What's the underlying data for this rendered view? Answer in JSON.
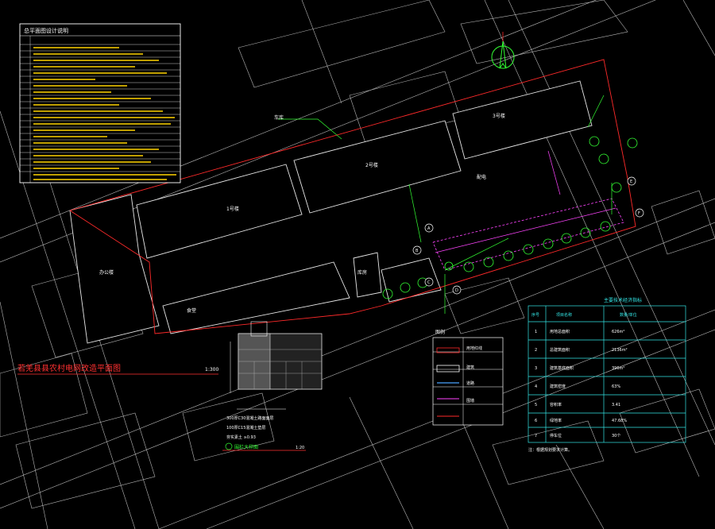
{
  "notes": {
    "title": "总平面图设计说明",
    "lines": [
      "1、本图尺寸以米计",
      "2、设计依据",
      "3、本工程建设用地范围",
      "4、室外地坪标高"
    ]
  },
  "drawing_title": {
    "text": "若羌县县农村电网改造平面图",
    "scale": "1:300"
  },
  "buildings": {
    "b1": "1号楼",
    "b2": "2号楼",
    "b3": "3号楼",
    "b4": "办公楼",
    "b5": "食堂",
    "b6": "库房",
    "b7": "配电",
    "b8": "车库"
  },
  "markers": [
    "A",
    "B",
    "C",
    "D",
    "E",
    "F"
  ],
  "legend": {
    "title": "图例",
    "items": [
      "用地红线",
      "建筑",
      "道路",
      "围墙"
    ]
  },
  "section": {
    "title": "围栏大样图",
    "scale": "1:20",
    "notes": [
      "300厚C30混凝土路面面层",
      "100厚C15混凝土垫层",
      "夯实素土 ≥0.93"
    ]
  },
  "table": {
    "title": "主要技术经济指标",
    "header": [
      "序号",
      "项目名称",
      "数量/单位"
    ],
    "rows": [
      [
        "1",
        "用地总面积",
        "626m²"
      ],
      [
        "2",
        "总建筑面积",
        "2136m²"
      ],
      [
        "3",
        "建筑基底面积",
        "396m²"
      ],
      [
        "4",
        "建筑密度",
        "63%"
      ],
      [
        "5",
        "容积率",
        "3.41"
      ],
      [
        "6",
        "绿地率",
        "47.68%"
      ],
      [
        "7",
        "停车位",
        "30个"
      ]
    ],
    "footnote": "注：根据规划要求计算。"
  },
  "colors": {
    "background": "#000000",
    "red_line": "#ff2a2a",
    "green_tree": "#33ff33",
    "cyan_table": "#33e6e6",
    "magenta": "#ff44ff"
  }
}
